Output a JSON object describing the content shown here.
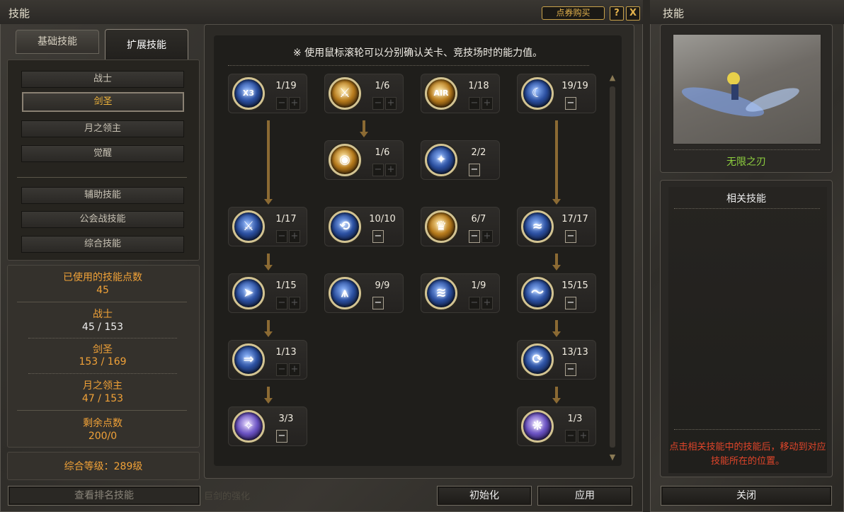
{
  "window": {
    "title": "技能",
    "shop_label": "点券购买",
    "help_label": "?",
    "close_label": "X"
  },
  "tabs": [
    {
      "label": "基础技能"
    },
    {
      "label": "扩展技能"
    }
  ],
  "menu": {
    "classes": [
      "战士",
      "剑圣",
      "月之领主",
      "觉醒"
    ],
    "selected": "剑圣",
    "other": [
      "辅助技能",
      "公会战技能",
      "综合技能"
    ]
  },
  "stats": {
    "used_label": "已使用的技能点数",
    "used_value": "45",
    "warrior_label": "战士",
    "warrior_value": "45 / 153",
    "swordmaster_label": "剑圣",
    "swordmaster_value": "153 / 169",
    "moonlord_label": "月之领主",
    "moonlord_value": "47 / 153",
    "remaining_label": "剩余点数",
    "remaining_value": "200/0"
  },
  "level_text": "综合等级：289级",
  "bottom": {
    "ranking": "查看排名技能",
    "faded": "巨剑的强化",
    "reset": "初始化",
    "apply": "应用"
  },
  "notice": "※ 使用鼠标滚轮可以分别确认关卡、竞技场时的能力值。",
  "skills": [
    {
      "level": "1/19",
      "icon": "x3-slash-icon",
      "glyph": "X3"
    },
    {
      "level": "1/6",
      "icon": "sword-light-icon",
      "glyph": "⚔"
    },
    {
      "level": "1/18",
      "icon": "air-slash-icon",
      "glyph": "AIR"
    },
    {
      "level": "19/19",
      "icon": "crescent-slash-icon",
      "glyph": "☾"
    },
    {
      "level": "1/6",
      "icon": "golden-shield-icon",
      "glyph": "◉"
    },
    {
      "level": "2/2",
      "icon": "spirit-icon",
      "glyph": "✦"
    },
    {
      "level": "1/17",
      "icon": "triple-sword-icon",
      "glyph": "⚔"
    },
    {
      "level": "10/10",
      "icon": "whirl-icon",
      "glyph": "⟲"
    },
    {
      "level": "6/7",
      "icon": "gold-crown-icon",
      "glyph": "♛"
    },
    {
      "level": "17/17",
      "icon": "wind-blade-icon",
      "glyph": "≈"
    },
    {
      "level": "1/15",
      "icon": "dash-icon",
      "glyph": "➤"
    },
    {
      "level": "9/9",
      "icon": "spike-icon",
      "glyph": "⩚"
    },
    {
      "level": "1/9",
      "icon": "multi-slash-icon",
      "glyph": "≋"
    },
    {
      "level": "15/15",
      "icon": "wave-slash-icon",
      "glyph": "〜"
    },
    {
      "level": "1/13",
      "icon": "thrust-icon",
      "glyph": "⇒"
    },
    {
      "level": "13/13",
      "icon": "cyclone-icon",
      "glyph": "⟳"
    },
    {
      "level": "3/3",
      "icon": "star-slash-icon",
      "glyph": "✧"
    },
    {
      "level": "1/3",
      "icon": "crystal-burst-icon",
      "glyph": "❋"
    }
  ],
  "right_panel": {
    "title": "技能",
    "skill_name": "无限之刃",
    "related_title": "相关技能",
    "hint": "点击相关技能中的技能后，移动到对应技能所在的位置。",
    "close": "关闭"
  },
  "colors": {
    "gold": "#f1a238",
    "selected": "#f1b53b",
    "hint": "#e0452a",
    "skill_name": "#8fd13f"
  }
}
